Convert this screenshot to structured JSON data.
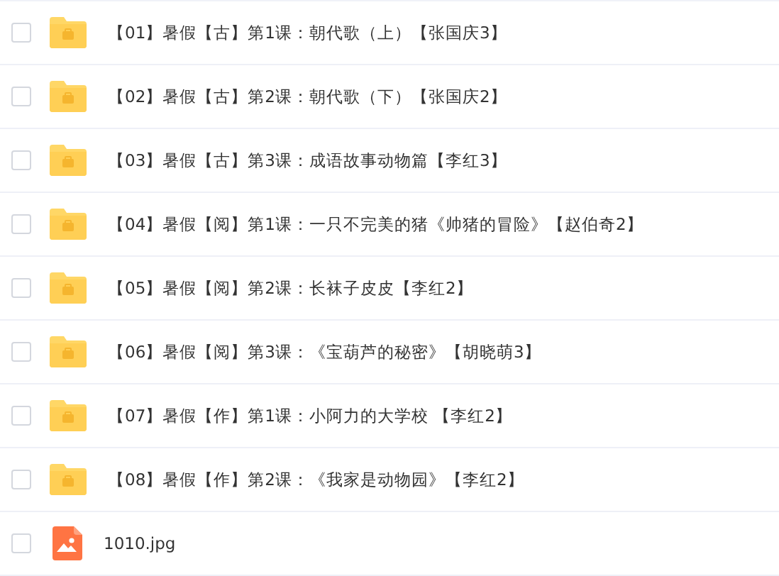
{
  "files": [
    {
      "kind": "folder",
      "name": "【01】暑假【古】第1课：朝代歌（上）【张国庆3】",
      "checked": false
    },
    {
      "kind": "folder",
      "name": "【02】暑假【古】第2课：朝代歌（下）【张国庆2】",
      "checked": false
    },
    {
      "kind": "folder",
      "name": "【03】暑假【古】第3课：成语故事动物篇【李红3】",
      "checked": false
    },
    {
      "kind": "folder",
      "name": "【04】暑假【阅】第1课：一只不完美的猪《帅猪的冒险》【赵伯奇2】",
      "checked": false
    },
    {
      "kind": "folder",
      "name": "【05】暑假【阅】第2课：长袜子皮皮【李红2】",
      "checked": false
    },
    {
      "kind": "folder",
      "name": "【06】暑假【阅】第3课：《宝葫芦的秘密》【胡晓萌3】",
      "checked": false
    },
    {
      "kind": "folder",
      "name": "【07】暑假【作】第1课：小阿力的大学校 【李红2】",
      "checked": false
    },
    {
      "kind": "folder",
      "name": "【08】暑假【作】第2课：《我家是动物园》【李红2】",
      "checked": false
    },
    {
      "kind": "image",
      "name": "1010.jpg",
      "checked": false
    }
  ]
}
